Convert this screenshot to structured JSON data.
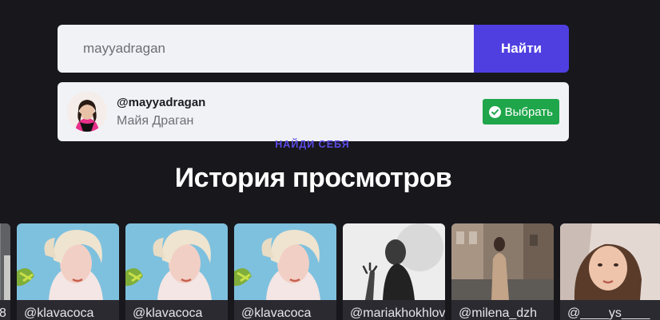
{
  "search": {
    "value": "mayyadragan",
    "button_label": "Найти"
  },
  "result": {
    "handle": "@mayyadragan",
    "name": "Майя Драган",
    "select_label": "Выбрать"
  },
  "tagline": "НАЙДИ СЕБЯ",
  "history": {
    "title": "История просмотров",
    "partial_label": "8",
    "cards": [
      {
        "handle": "@klavacoca",
        "thumb": "blonde-teal"
      },
      {
        "handle": "@klavacoca",
        "thumb": "blonde-teal"
      },
      {
        "handle": "@klavacoca",
        "thumb": "blonde-teal"
      },
      {
        "handle": "@mariakhokhlova",
        "thumb": "monochrome"
      },
      {
        "handle": "@milena_dzh",
        "thumb": "street"
      },
      {
        "handle": "@____ys____",
        "thumb": "portrait"
      }
    ]
  },
  "colors": {
    "background": "#18171c",
    "accent": "#4f3fe0",
    "success": "#1fa64a"
  }
}
